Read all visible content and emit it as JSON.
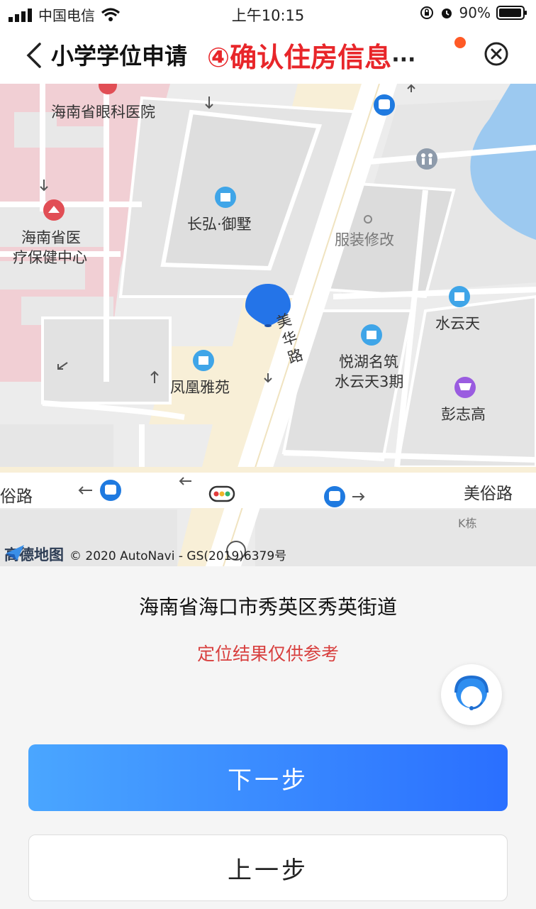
{
  "status_bar": {
    "carrier": "中国电信",
    "time": "上午10:15",
    "battery": "90%"
  },
  "nav": {
    "title": "小学学位申请",
    "annotation": "④确认住房信息",
    "more": "···"
  },
  "map": {
    "labels": {
      "eye_hospital": "海南省眼科医院",
      "health_center_1": "海南省医",
      "health_center_2": "疗保健中心",
      "changhong": "长弘·御墅",
      "clothing": "服装修改",
      "shuiyuntian": "水云天",
      "yuehu_1": "悦湖名筑",
      "yuehu_2": "水云天3期",
      "fenghuang": "凤凰雅苑",
      "pengzhigao": "彭志高",
      "meihua_road": "美华路",
      "meisu_road": "美俗路",
      "su_road": "俗路",
      "k_building": "K栋"
    },
    "logo": "高德地图",
    "attribution": "© 2020 AutoNavi - GS(2019)6379号"
  },
  "location": {
    "address": "海南省海口市秀英区秀英街道",
    "hint": "定位结果仅供参考"
  },
  "buttons": {
    "next": "下一步",
    "prev": "上一步"
  }
}
